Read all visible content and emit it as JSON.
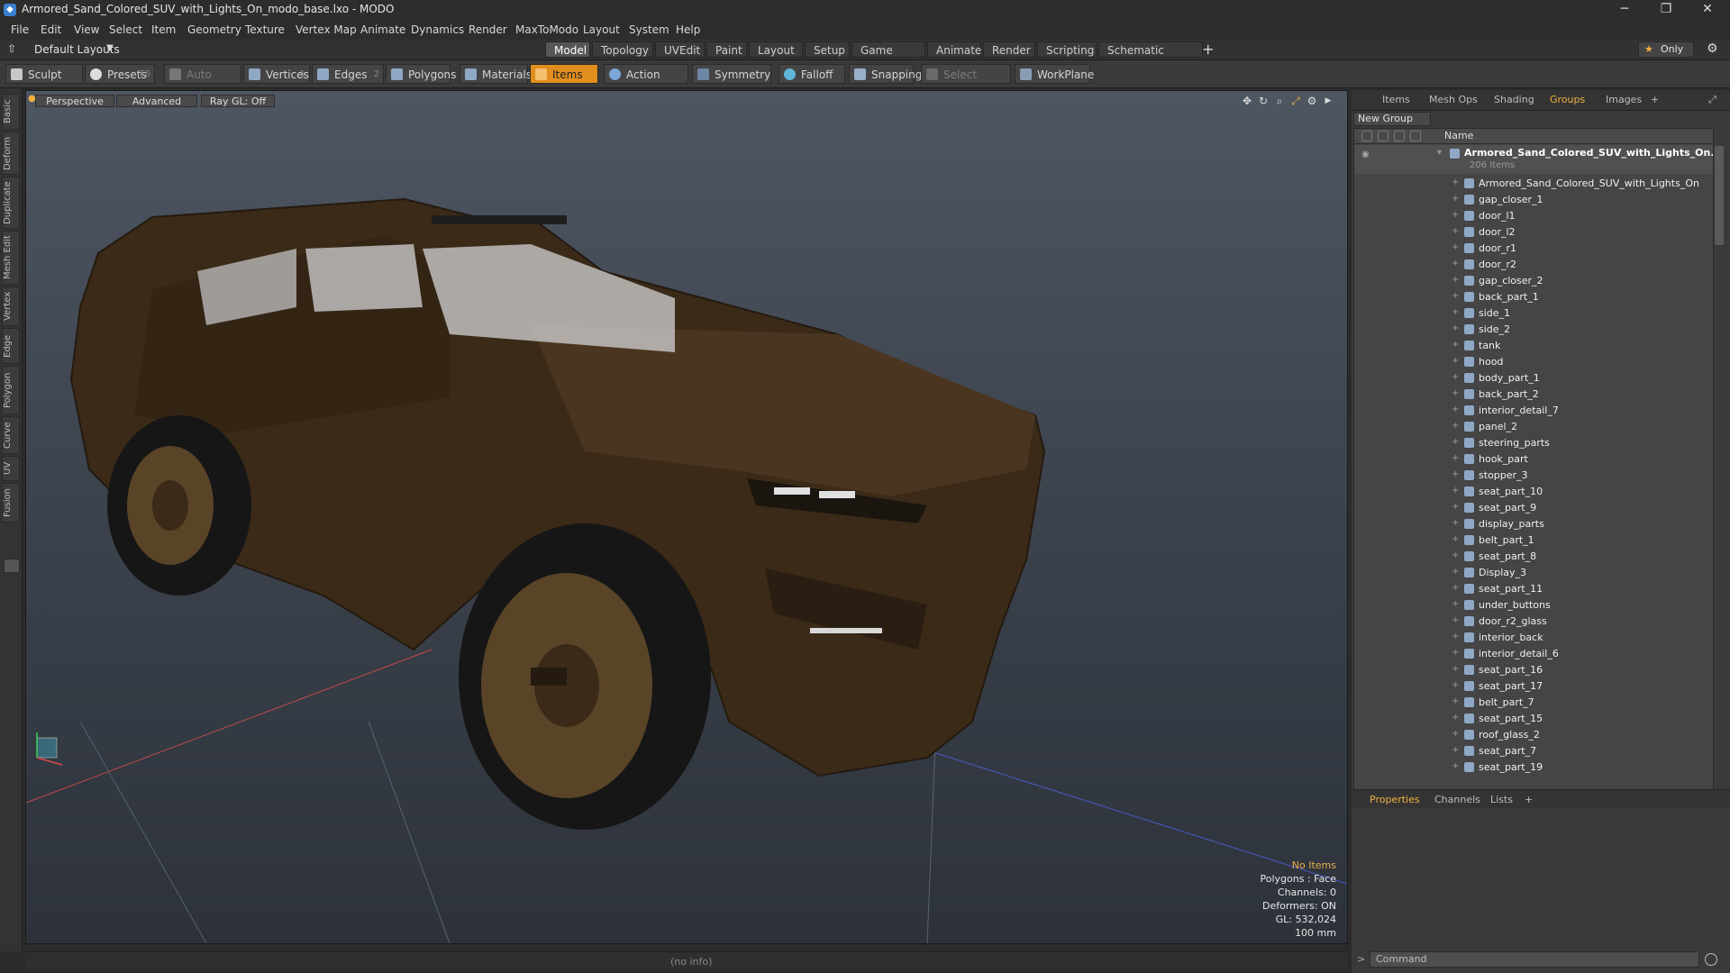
{
  "window": {
    "title": "Armored_Sand_Colored_SUV_with_Lights_On_modo_base.lxo - MODO",
    "app_icon": "modo-icon",
    "controls": [
      "─",
      "❐",
      "✕"
    ]
  },
  "menu": [
    "File",
    "Edit",
    "View",
    "Select",
    "Item",
    "Geometry",
    "Texture",
    "Vertex Map",
    "Animate",
    "Dynamics",
    "Render",
    "MaxToModo",
    "Layout",
    "System",
    "Help"
  ],
  "layout_row": {
    "layout_name": "Default Layouts",
    "tabs": [
      "Model",
      "Topology",
      "UVEdit",
      "Paint",
      "Layout",
      "Setup",
      "Game Tools",
      "Animate",
      "Render",
      "Scripting",
      "Schematic Fusion"
    ],
    "active_tab": "Model",
    "add_tab": "+",
    "only_label": "Only",
    "only_icon": "★"
  },
  "toolbar": {
    "sculpt": "Sculpt",
    "presets": "Presets",
    "presets_key": "F6",
    "auto_select": "Auto Select",
    "vertices": "Vertices",
    "vertices_count": "1",
    "edges": "Edges",
    "edges_count": "2",
    "polygons": "Polygons",
    "materials": "Materials",
    "items": "Items",
    "action_center": "Action Center",
    "symmetry": "Symmetry",
    "falloff": "Falloff",
    "snapping": "Snapping",
    "select_through": "Select Through",
    "workplane": "WorkPlane"
  },
  "left_tabs": [
    "Basic",
    "Deform",
    "Duplicate",
    "Mesh Edit",
    "Vertex",
    "Edge",
    "Polygon",
    "Curve",
    "UV",
    "Fusion"
  ],
  "viewport": {
    "view": "Perspective",
    "shading": "Advanced",
    "raygl": "Ray GL: Off",
    "info": {
      "items": "No Items",
      "polygons": "Polygons : Face",
      "channels": "Channels: 0",
      "deformers": "Deformers: ON",
      "gl": "GL: 532,024",
      "unit": "100 mm"
    }
  },
  "status": "(no info)",
  "right_panel": {
    "tabs": [
      "Items",
      "Mesh Ops",
      "Shading",
      "Groups",
      "Images"
    ],
    "active_tab": "Groups",
    "new_group": "New Group",
    "column_name": "Name",
    "group": {
      "name": "Armored_Sand_Colored_SUV_with_Lights_On...",
      "count": "206 Items"
    },
    "items": [
      "Armored_Sand_Colored_SUV_with_Lights_On",
      "gap_closer_1",
      "door_l1",
      "door_l2",
      "door_r1",
      "door_r2",
      "gap_closer_2",
      "back_part_1",
      "side_1",
      "side_2",
      "tank",
      "hood",
      "body_part_1",
      "back_part_2",
      "interior_detail_7",
      "panel_2",
      "steering_parts",
      "hook_part",
      "stopper_3",
      "seat_part_10",
      "seat_part_9",
      "display_parts",
      "belt_part_1",
      "seat_part_8",
      "Display_3",
      "seat_part_11",
      "under_buttons",
      "door_r2_glass",
      "interior_back",
      "interior_detail_6",
      "seat_part_16",
      "seat_part_17",
      "belt_part_7",
      "seat_part_15",
      "roof_glass_2",
      "seat_part_7",
      "seat_part_19"
    ],
    "bottom_tabs": [
      "Properties",
      "Channels",
      "Lists"
    ],
    "bottom_active": "Properties",
    "command_placeholder": "Command"
  },
  "colors": {
    "accent": "#e08e1d",
    "active_tab_text": "#f0b040",
    "list_bg": "#454545",
    "vehicle": "#3b2a18"
  }
}
